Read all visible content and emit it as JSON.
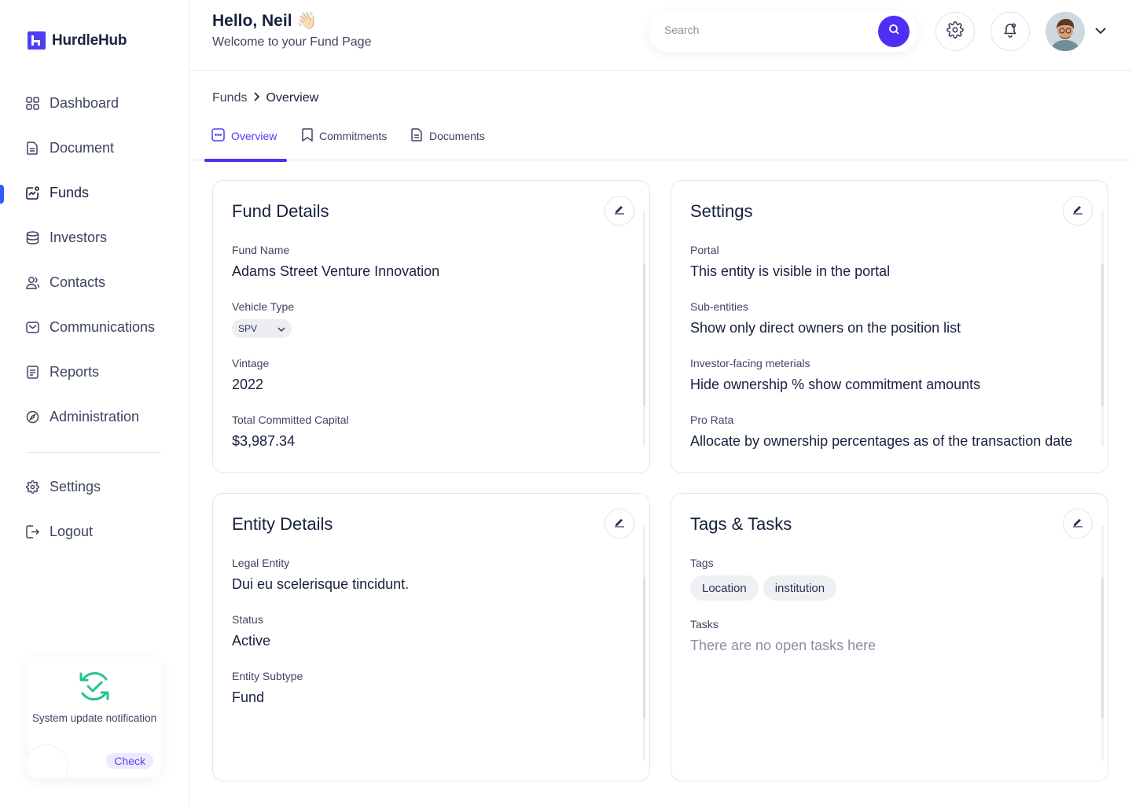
{
  "app": {
    "name": "HurdleHub"
  },
  "header": {
    "greeting": "Hello, Neil",
    "greeting_emoji": "👋🏻",
    "subtitle": "Welcome to your Fund Page",
    "search_placeholder": "Search"
  },
  "sidebar": {
    "items": [
      {
        "label": "Dashboard",
        "icon": "grid-icon"
      },
      {
        "label": "Document",
        "icon": "document-icon"
      },
      {
        "label": "Funds",
        "icon": "chart-icon",
        "active": true
      },
      {
        "label": "Investors",
        "icon": "database-icon"
      },
      {
        "label": "Contacts",
        "icon": "contacts-icon"
      },
      {
        "label": "Communications",
        "icon": "mail-icon"
      },
      {
        "label": "Reports",
        "icon": "report-icon"
      },
      {
        "label": "Administration",
        "icon": "compass-icon"
      }
    ],
    "secondary": [
      {
        "label": "Settings",
        "icon": "gear-icon"
      },
      {
        "label": "Logout",
        "icon": "logout-icon"
      }
    ],
    "update_card": {
      "text": "System update notification",
      "button": "Check"
    }
  },
  "breadcrumb": {
    "parent": "Funds",
    "current": "Overview"
  },
  "tabs": [
    {
      "label": "Overview",
      "active": true
    },
    {
      "label": "Commitments"
    },
    {
      "label": "Documents"
    }
  ],
  "fund_details": {
    "title": "Fund Details",
    "fund_name_label": "Fund Name",
    "fund_name": "Adams Street Venture Innovation",
    "vehicle_type_label": "Vehicle Type",
    "vehicle_type": "SPV",
    "vintage_label": "Vintage",
    "vintage": "2022",
    "capital_label": "Total Committed Capital",
    "capital": "$3,987.34"
  },
  "settings": {
    "title": "Settings",
    "portal_label": "Portal",
    "portal": "This entity is visible in the portal",
    "sub_entities_label": "Sub-entities",
    "sub_entities": "Show only direct owners on the position list",
    "materials_label": "Investor-facing meterials",
    "materials": "Hide ownership % show commitment amounts",
    "pro_rata_label": "Pro Rata",
    "pro_rata": "Allocate by ownership percentages as of the transaction date"
  },
  "entity_details": {
    "title": "Entity Details",
    "legal_entity_label": "Legal Entity",
    "legal_entity": "Dui eu scelerisque tincidunt.",
    "status_label": "Status",
    "status": "Active",
    "subtype_label": "Entity Subtype",
    "subtype": "Fund"
  },
  "tags_tasks": {
    "title": "Tags & Tasks",
    "tags_label": "Tags",
    "tags": [
      "Location",
      "institution"
    ],
    "tasks_label": "Tasks",
    "tasks_empty": "There are no open tasks here"
  },
  "colors": {
    "accent": "#4f2ef5",
    "active_indicator": "#2f5bff",
    "update_icon": "#22c58b"
  }
}
